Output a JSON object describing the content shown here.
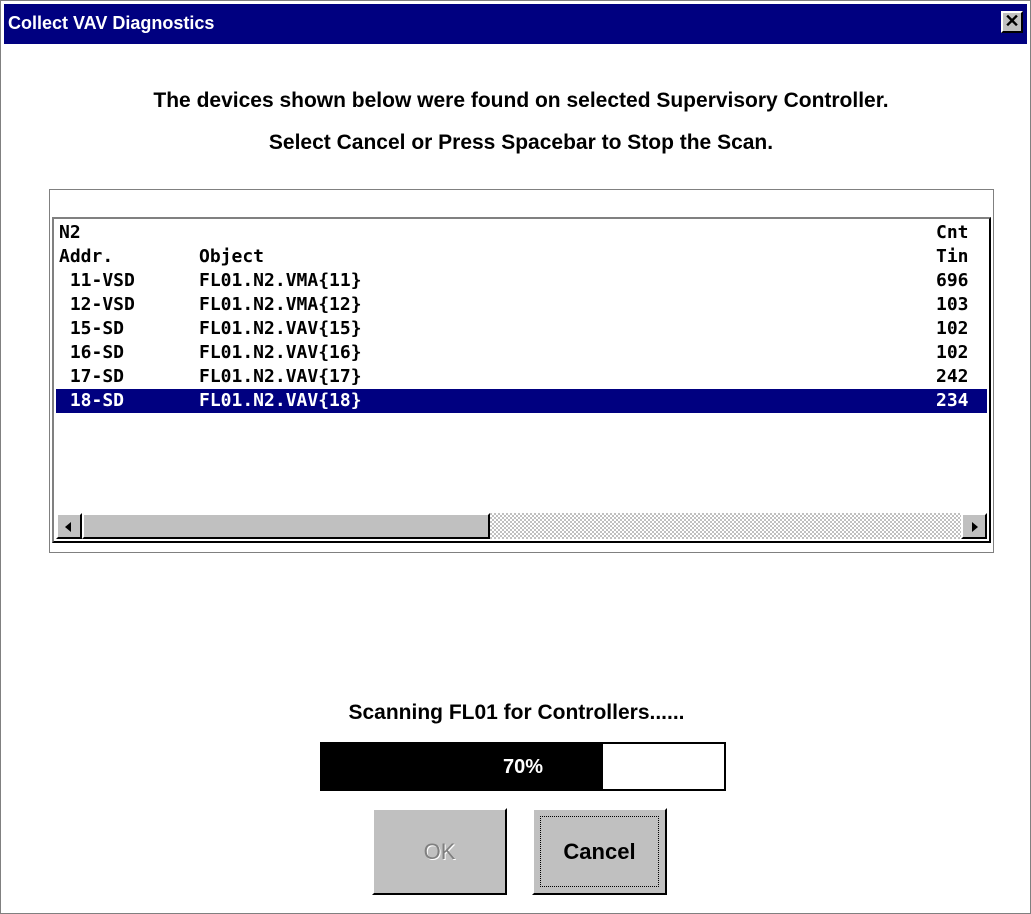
{
  "window": {
    "title": "Collect VAV Diagnostics",
    "close_glyph": "✕",
    "close_icon": "close-icon"
  },
  "instructions": {
    "line1": "The devices shown below were found on selected Supervisory Controller.",
    "line2": "Select Cancel or Press Spacebar to Stop the Scan."
  },
  "device_list": {
    "header_row1": {
      "addr": "N2",
      "object": "",
      "cnt": "Cnt"
    },
    "header_row2": {
      "addr": "Addr.",
      "object": "Object",
      "cnt": "Tin"
    },
    "rows": [
      {
        "addr": " 11-VSD",
        "object": "FL01.N2.VMA{11}",
        "cnt": "696"
      },
      {
        "addr": " 12-VSD",
        "object": "FL01.N2.VMA{12}",
        "cnt": "103"
      },
      {
        "addr": " 15-SD",
        "object": "FL01.N2.VAV{15}",
        "cnt": "102"
      },
      {
        "addr": " 16-SD",
        "object": "FL01.N2.VAV{16}",
        "cnt": "102"
      },
      {
        "addr": " 17-SD",
        "object": "FL01.N2.VAV{17}",
        "cnt": "242"
      },
      {
        "addr": " 18-SD",
        "object": "FL01.N2.VAV{18}",
        "cnt": "234",
        "selected": true
      }
    ],
    "scrollbar": {
      "left_icon": "arrow-left-icon",
      "right_icon": "arrow-right-icon"
    }
  },
  "status": {
    "text": "Scanning FL01 for Controllers......"
  },
  "progress": {
    "percent": 70,
    "label": "70%"
  },
  "buttons": {
    "ok_label": "OK",
    "ok_enabled": false,
    "cancel_label": "Cancel"
  },
  "colors": {
    "titlebar": "#000080",
    "selection": "#000080",
    "face": "#c0c0c0"
  }
}
